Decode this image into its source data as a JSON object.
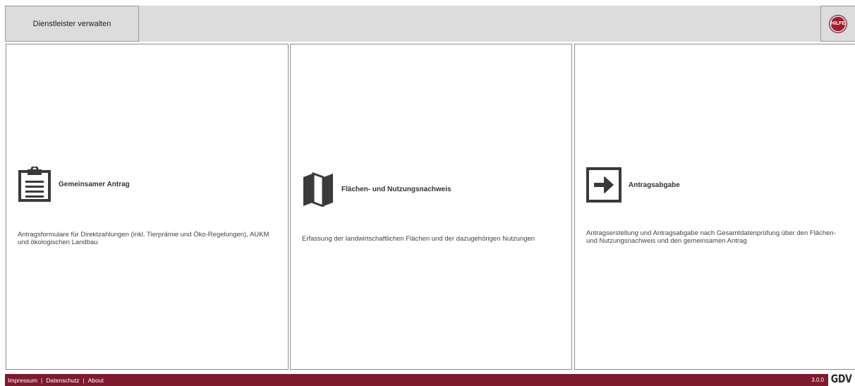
{
  "header": {
    "manage_button": "Dienstleister verwalten",
    "help_button": "HILFE"
  },
  "tiles": [
    {
      "title": "Gemeinsamer Antrag",
      "icon": "clipboard-icon",
      "description": "Antragsformulare für Direktzahlungen (inkl. Tierprämie und Öko-Regelungen), AUKM und ökologischen Landbau"
    },
    {
      "title": "Flächen- und Nutzungsnachweis",
      "icon": "folded-map-icon",
      "description": "Erfassung der landwirtschaftlichen Flächen und der dazugehörigen Nutzungen"
    },
    {
      "title": "Antragsabgabe",
      "icon": "arrow-right-box-icon",
      "description": "Antragserstellung und Antragsabgabe nach Gesamtdatenprüfung über den Flächen- und Nutzungsnachweis und den gemeinsamen Antrag"
    }
  ],
  "footer": {
    "links": [
      "Impressum",
      "Datenschutz",
      "About"
    ],
    "separator": "|",
    "version": "3.0.0",
    "logo": "GDV"
  },
  "colors": {
    "footer_bg": "#7d1a2d",
    "help_red": "#a31c2b",
    "topbar_bg": "#dcdcdc",
    "icon_dark": "#3a3a3a"
  }
}
